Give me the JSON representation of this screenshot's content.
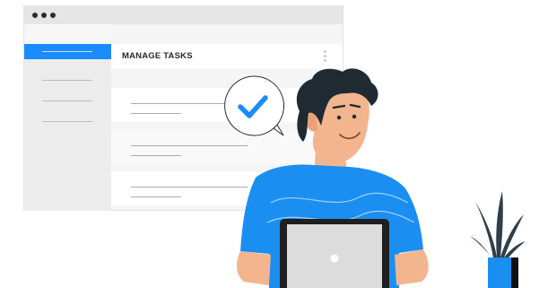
{
  "main": {
    "title": "MANAGE TASKS"
  },
  "icons": {
    "check": "checkmark-icon",
    "menu": "kebab-menu-icon",
    "window_controls": "window-dots-icon"
  },
  "colors": {
    "accent": "#1a8cff",
    "shirt": "#1b8ef2",
    "hair": "#1f2a33",
    "skin": "#f2b58e",
    "laptop": "#dcdcdc"
  }
}
